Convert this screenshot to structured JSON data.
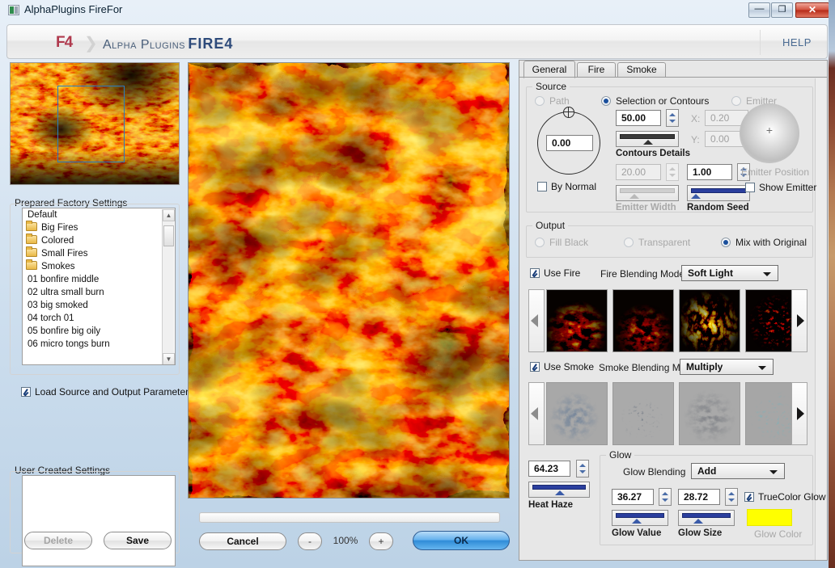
{
  "window": {
    "title": "AlphaPlugins FireFor",
    "buttons": {
      "minimize": "—",
      "maximize": "❐",
      "close": "✕"
    }
  },
  "header": {
    "logo": "F4",
    "chevron": "❯",
    "brand_part1": "Alpha Plugins",
    "brand_part2": "FIRE",
    "brand_part3": "4",
    "help": "HELP"
  },
  "left": {
    "factory_group_title": "Prepared Factory Settings",
    "factory_items": [
      {
        "label": "Default",
        "folder": false
      },
      {
        "label": "Big Fires",
        "folder": true
      },
      {
        "label": "Colored",
        "folder": true
      },
      {
        "label": "Small Fires",
        "folder": true
      },
      {
        "label": "Smokes",
        "folder": true
      },
      {
        "label": "01 bonfire middle",
        "folder": false
      },
      {
        "label": "02 ultra small burn",
        "folder": false
      },
      {
        "label": "03 big smoked",
        "folder": false
      },
      {
        "label": "04 torch 01",
        "folder": false
      },
      {
        "label": "05 bonfire big oily",
        "folder": false
      },
      {
        "label": "06 micro tongs burn",
        "folder": false
      }
    ],
    "scroll_up": "▲",
    "scroll_down": "▼",
    "load_params_label": "Load Source and Output Parameters",
    "load_params_checked": true,
    "user_group_title": "User Created Settings",
    "delete_label": "Delete",
    "delete_enabled": false,
    "save_label": "Save"
  },
  "center": {
    "cancel_label": "Cancel",
    "zoom_out_label": "-",
    "zoom_value": "100%",
    "zoom_in_label": "+",
    "ok_label": "OK"
  },
  "right": {
    "tabs": [
      {
        "label": "General",
        "active": true
      },
      {
        "label": "Fire",
        "active": false
      },
      {
        "label": "Smoke",
        "active": false
      }
    ],
    "source": {
      "legend": "Source",
      "radios": [
        {
          "label": "Path",
          "selected": false,
          "disabled": true
        },
        {
          "label": "Selection or Contours",
          "selected": true,
          "disabled": false
        },
        {
          "label": "Emitter",
          "selected": false,
          "disabled": true
        }
      ],
      "dial_value": "0.00",
      "by_normal_label": "By Normal",
      "by_normal_checked": false,
      "contours_details_value": "50.00",
      "contours_details_label": "Contours Details",
      "emitter_width_value": "20.00",
      "emitter_width_label": "Emitter Width",
      "emitter_width_disabled": true,
      "random_seed_value": "1.00",
      "random_seed_label": "Random Seed",
      "x_label": "X:",
      "x_value": "0.20",
      "y_label": "Y:",
      "y_value": "0.00",
      "emitter_position_label": "Emitter Position",
      "emitter_position_disabled": true,
      "show_emitter_label": "Show Emitter",
      "show_emitter_checked": false
    },
    "output": {
      "legend": "Output",
      "radios": [
        {
          "label": "Fill Black",
          "selected": false,
          "disabled": true
        },
        {
          "label": "Transparent",
          "selected": false,
          "disabled": true
        },
        {
          "label": "Mix with Original",
          "selected": true,
          "disabled": false
        }
      ]
    },
    "fire": {
      "use_fire_label": "Use Fire",
      "use_fire_checked": true,
      "blending_mode_label": "Fire Blending Mode",
      "blending_mode_value": "Soft Light",
      "prev_arrow": "◀",
      "next_arrow": "▶",
      "thumbnails": [
        "fire-preset-1",
        "fire-preset-2",
        "fire-preset-3",
        "fire-preset-4"
      ]
    },
    "smoke": {
      "use_smoke_label": "Use Smoke",
      "use_smoke_checked": true,
      "blending_mode_label": "Smoke Blending Mode",
      "blending_mode_value": "Multiply",
      "prev_arrow": "◀",
      "next_arrow": "▶",
      "thumbnails": [
        "smoke-preset-1",
        "smoke-preset-2",
        "smoke-preset-3",
        "smoke-preset-4"
      ]
    },
    "heat_haze": {
      "value": "64.23",
      "label": "Heat Haze"
    },
    "glow": {
      "legend": "Glow",
      "blending_label": "Glow Blending",
      "blending_value": "Add",
      "value_number": "36.27",
      "value_label": "Glow Value",
      "size_number": "28.72",
      "size_label": "Glow Size",
      "truecolor_label": "TrueColor Glow",
      "truecolor_checked": true,
      "color_label": "Glow Color",
      "color_hex": "#FFFF00",
      "color_disabled": true
    }
  }
}
